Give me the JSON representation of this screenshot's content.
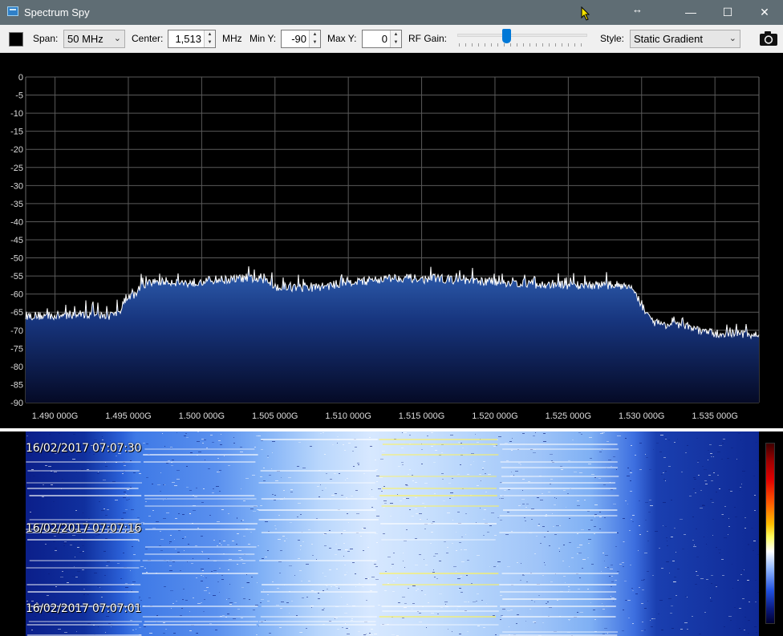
{
  "window": {
    "title": "Spectrum Spy",
    "controls": {
      "minimize": "—",
      "maximize": "☐",
      "close": "✕",
      "resize": "↔"
    }
  },
  "toolbar": {
    "color_swatch": "#000000",
    "span_label": "Span:",
    "span_value": "50 MHz",
    "center_label": "Center:",
    "center_value": "1,513",
    "center_unit": "MHz",
    "miny_label": "Min Y:",
    "miny_value": "-90",
    "maxy_label": "Max Y:",
    "maxy_value": "0",
    "rfgain_label": "RF Gain:",
    "rfgain_fraction": 0.38,
    "style_label": "Style:",
    "style_value": "Static Gradient",
    "camera_icon": "camera-icon"
  },
  "chart_data": {
    "type": "area",
    "ylim": [
      -90,
      0
    ],
    "y_ticks": [
      0,
      -5,
      -10,
      -15,
      -20,
      -25,
      -30,
      -35,
      -40,
      -45,
      -50,
      -55,
      -60,
      -65,
      -70,
      -75,
      -80,
      -85,
      -90
    ],
    "x_tick_labels": [
      "1.490 000G",
      "1.495 000G",
      "1.500 000G",
      "1.505 000G",
      "1.510 000G",
      "1.515 000G",
      "1.520 000G",
      "1.525 000G",
      "1.530 000G",
      "1.535 000G"
    ],
    "x_ticks_ghz": [
      1.49,
      1.495,
      1.5,
      1.505,
      1.51,
      1.515,
      1.52,
      1.525,
      1.53,
      1.535
    ],
    "xlim_ghz": [
      1.488,
      1.538
    ],
    "grid": true,
    "series": [
      {
        "x_ghz": [
          1.488,
          1.49,
          1.492,
          1.493,
          1.494,
          1.4945,
          1.495,
          1.4955,
          1.496,
          1.497,
          1.498,
          1.499,
          1.5,
          1.501,
          1.502,
          1.503,
          1.504,
          1.5045,
          1.505,
          1.506,
          1.507,
          1.508,
          1.509,
          1.51,
          1.511,
          1.512,
          1.513,
          1.514,
          1.515,
          1.516,
          1.517,
          1.518,
          1.519,
          1.52,
          1.521,
          1.522,
          1.523,
          1.524,
          1.525,
          1.526,
          1.527,
          1.528,
          1.529,
          1.5295,
          1.53,
          1.5305,
          1.531,
          1.532,
          1.533,
          1.534,
          1.535,
          1.536,
          1.537,
          1.538
        ],
        "y_db": [
          -66,
          -66,
          -65.5,
          -66,
          -66,
          -64,
          -61,
          -60,
          -57.5,
          -56.5,
          -56.5,
          -57,
          -56.5,
          -56,
          -56,
          -55.5,
          -56,
          -56.5,
          -58,
          -58,
          -58.5,
          -58,
          -57.5,
          -56.5,
          -56.5,
          -56,
          -55.5,
          -55.5,
          -56,
          -55.5,
          -56,
          -56.5,
          -56.5,
          -56.5,
          -57,
          -57,
          -57.5,
          -57.5,
          -57.5,
          -57.5,
          -57.5,
          -57.5,
          -57.5,
          -59,
          -63,
          -67,
          -68,
          -68.5,
          -69,
          -70,
          -71,
          -71,
          -71,
          -71.5
        ]
      }
    ]
  },
  "waterfall": {
    "timestamps": [
      "16/02/2017 07:07:30",
      "16/02/2017 07:07:16",
      "16/02/2017 07:07:01"
    ]
  }
}
